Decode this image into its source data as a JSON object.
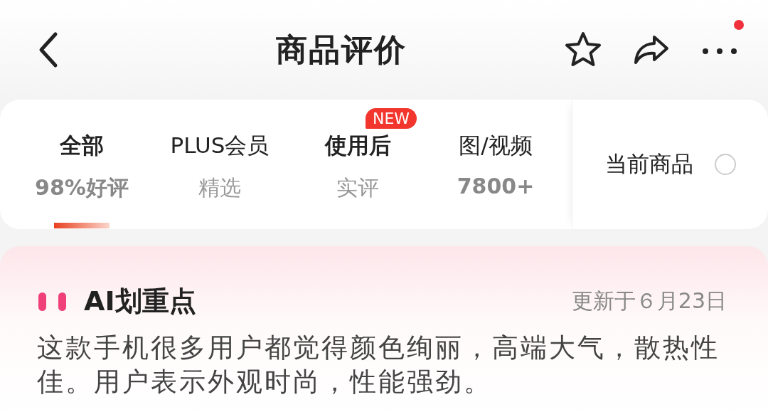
{
  "header": {
    "title": "商品评价",
    "notification_dot": true
  },
  "tabs": [
    {
      "label": "全部",
      "sub": "98%好评",
      "selected": true,
      "bold": true,
      "sub_bold": true
    },
    {
      "label": "PLUS会员",
      "sub": "精选",
      "selected": false,
      "bold": false,
      "sub_bold": false
    },
    {
      "label": "使用后",
      "sub": "实评",
      "selected": false,
      "bold": true,
      "sub_bold": false,
      "badge": "NEW"
    },
    {
      "label": "图/视频",
      "sub": "7800+",
      "selected": false,
      "bold": false,
      "sub_bold": true
    }
  ],
  "filter": {
    "label": "当前商品",
    "checked": false
  },
  "summary": {
    "title": "AI划重点",
    "updated": "更新于６月23日",
    "text": "这款手机很多用户都觉得颜色绚丽，高端大气，散热性佳。用户表示外观时尚，性能强劲。"
  }
}
